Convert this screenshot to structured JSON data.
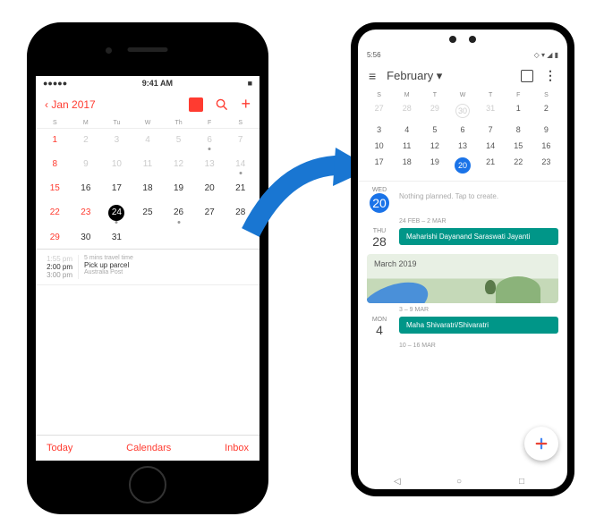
{
  "ios": {
    "status": {
      "carrier": "●●●●●",
      "time": "9:41 AM",
      "battery": "■"
    },
    "header_back": "Jan 2017",
    "dow": [
      "S",
      "M",
      "Tu",
      "W",
      "Th",
      "F",
      "S"
    ],
    "grid": [
      {
        "n": "1",
        "cls": "red dim"
      },
      {
        "n": "2",
        "cls": "dim"
      },
      {
        "n": "3",
        "cls": "dim"
      },
      {
        "n": "4",
        "cls": "dim"
      },
      {
        "n": "5",
        "cls": "dim"
      },
      {
        "n": "6",
        "cls": "dim dot"
      },
      {
        "n": "7",
        "cls": "dim"
      },
      {
        "n": "8",
        "cls": "red dim"
      },
      {
        "n": "9",
        "cls": "dim"
      },
      {
        "n": "10",
        "cls": "dim"
      },
      {
        "n": "11",
        "cls": "dim"
      },
      {
        "n": "12",
        "cls": "dim"
      },
      {
        "n": "13",
        "cls": "dim"
      },
      {
        "n": "14",
        "cls": "dim dot"
      },
      {
        "n": "15",
        "cls": "red"
      },
      {
        "n": "16",
        "cls": ""
      },
      {
        "n": "17",
        "cls": ""
      },
      {
        "n": "18",
        "cls": ""
      },
      {
        "n": "19",
        "cls": ""
      },
      {
        "n": "20",
        "cls": ""
      },
      {
        "n": "21",
        "cls": ""
      },
      {
        "n": "22",
        "cls": "red"
      },
      {
        "n": "23",
        "cls": "red"
      },
      {
        "n": "24",
        "cls": "sel dot"
      },
      {
        "n": "25",
        "cls": ""
      },
      {
        "n": "26",
        "cls": "dot"
      },
      {
        "n": "27",
        "cls": ""
      },
      {
        "n": "28",
        "cls": ""
      },
      {
        "n": "29",
        "cls": "red"
      },
      {
        "n": "30",
        "cls": ""
      },
      {
        "n": "31",
        "cls": ""
      },
      {
        "n": "",
        "cls": ""
      },
      {
        "n": "",
        "cls": ""
      },
      {
        "n": "",
        "cls": ""
      },
      {
        "n": "",
        "cls": ""
      }
    ],
    "event": {
      "time_pre": "1:55 pm",
      "time_start": "2:00 pm",
      "time_end": "3:00 pm",
      "travel": "5 mins travel time",
      "title": "Pick up parcel",
      "location": "Australia Post"
    },
    "footer": {
      "today": "Today",
      "calendars": "Calendars",
      "inbox": "Inbox"
    }
  },
  "android": {
    "status": {
      "time": "5:56",
      "icons": "◇ ▾ ◢ ▮"
    },
    "month": "February ▾",
    "dow": [
      "S",
      "M",
      "T",
      "W",
      "T",
      "F",
      "S"
    ],
    "grid": [
      {
        "n": "27",
        "cls": "dim"
      },
      {
        "n": "28",
        "cls": "dim"
      },
      {
        "n": "29",
        "cls": "dim"
      },
      {
        "n": "30",
        "cls": "dim ring"
      },
      {
        "n": "31",
        "cls": "dim"
      },
      {
        "n": "1",
        "cls": ""
      },
      {
        "n": "2",
        "cls": ""
      },
      {
        "n": "3",
        "cls": ""
      },
      {
        "n": "4",
        "cls": ""
      },
      {
        "n": "5",
        "cls": ""
      },
      {
        "n": "6",
        "cls": ""
      },
      {
        "n": "7",
        "cls": ""
      },
      {
        "n": "8",
        "cls": ""
      },
      {
        "n": "9",
        "cls": ""
      },
      {
        "n": "10",
        "cls": ""
      },
      {
        "n": "11",
        "cls": ""
      },
      {
        "n": "12",
        "cls": ""
      },
      {
        "n": "13",
        "cls": ""
      },
      {
        "n": "14",
        "cls": ""
      },
      {
        "n": "15",
        "cls": ""
      },
      {
        "n": "16",
        "cls": ""
      },
      {
        "n": "17",
        "cls": ""
      },
      {
        "n": "18",
        "cls": ""
      },
      {
        "n": "19",
        "cls": ""
      },
      {
        "n": "20",
        "cls": "sel"
      },
      {
        "n": "21",
        "cls": ""
      },
      {
        "n": "22",
        "cls": ""
      },
      {
        "n": "23",
        "cls": ""
      }
    ],
    "agenda": {
      "today": {
        "dw": "WED",
        "dn": "20",
        "text": "Nothing planned. Tap to create."
      },
      "range1": "24 FEB – 2 MAR",
      "day28": {
        "dw": "THU",
        "dn": "28",
        "chip": "Maharishi Dayanand Saraswati Jayanti"
      },
      "month_banner": "March 2019",
      "range2": "3 – 9 MAR",
      "day4": {
        "dw": "MON",
        "dn": "4",
        "chip": "Maha Shivaratri/Shivaratri"
      },
      "range3": "10 – 16 MAR"
    }
  }
}
